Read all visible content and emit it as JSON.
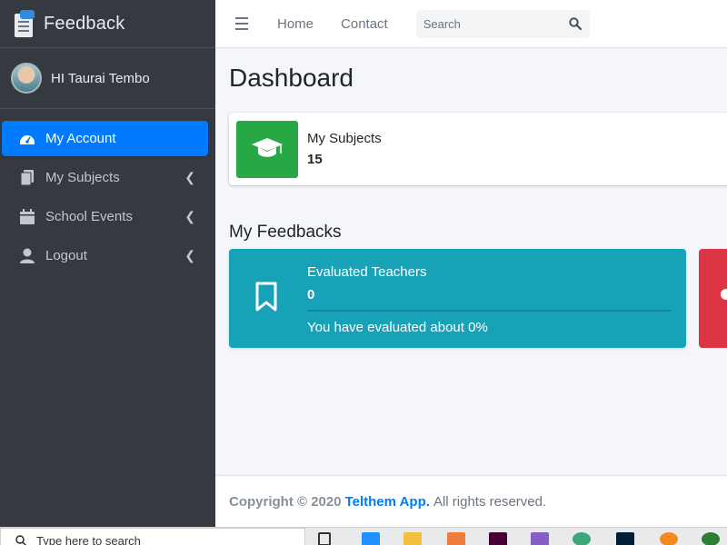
{
  "brand": {
    "title": "Feedback"
  },
  "user": {
    "greeting": "HI Taurai Tembo"
  },
  "sidebar": {
    "items": [
      {
        "label": "My Account",
        "icon": "tachometer-icon",
        "active": true
      },
      {
        "label": "My Subjects",
        "icon": "copy-icon",
        "active": false
      },
      {
        "label": "School Events",
        "icon": "calendar-icon",
        "active": false
      },
      {
        "label": "Logout",
        "icon": "user-icon",
        "active": false
      }
    ],
    "chevron": "❮"
  },
  "navbar": {
    "home": "Home",
    "contact": "Contact",
    "search_placeholder": "Search"
  },
  "page": {
    "title": "Dashboard"
  },
  "subjects_box": {
    "label": "My Subjects",
    "value": "15",
    "icon": "graduation-cap-icon",
    "color": "#28a745"
  },
  "feedbacks": {
    "title": "My Feedbacks",
    "evaluated": {
      "label": "Evaluated Teachers",
      "value": "0",
      "progress": 0,
      "description": "You have evaluated about 0%",
      "icon": "bookmark-icon",
      "color": "#17a2b8"
    },
    "second_box_color": "#dc3545"
  },
  "footer": {
    "copyright": "Copyright © 2020",
    "brand": "Telthem App.",
    "rights": "All rights reserved."
  },
  "taskbar": {
    "search_placeholder": "Type here to search"
  },
  "colors": {
    "sidebar": "#343a40",
    "primary": "#007bff",
    "success": "#28a745",
    "info": "#17a2b8",
    "danger": "#dc3545"
  }
}
